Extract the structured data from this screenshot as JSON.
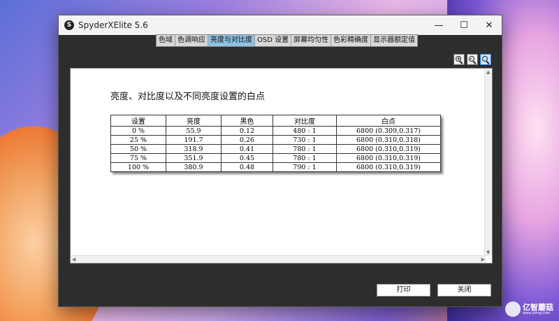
{
  "window": {
    "title": "SpyderXElite 5.6",
    "app_icon": "S"
  },
  "controls": {
    "minimize": "—",
    "maximize": "☐",
    "close": "✕"
  },
  "tabs": [
    {
      "label": "色域"
    },
    {
      "label": "色调响应"
    },
    {
      "label": "亮度与对比度",
      "active": true
    },
    {
      "label": "OSD 设置"
    },
    {
      "label": "屏幕均匀性"
    },
    {
      "label": "色彩精确度"
    },
    {
      "label": "显示器额定值"
    }
  ],
  "document": {
    "title": "亮度、对比度以及不同亮度设置的白点",
    "table": {
      "headers": [
        "设置",
        "亮度",
        "黑色",
        "对比度",
        "白点"
      ],
      "rows": [
        [
          "0 %",
          "55.9",
          "0.12",
          "480 : 1",
          "6800 (0.309,0.317)"
        ],
        [
          "25 %",
          "191.7",
          "0.26",
          "730 : 1",
          "6800 (0.310,0.318)"
        ],
        [
          "50 %",
          "318.9",
          "0.41",
          "780 : 1",
          "6800 (0.310,0.319)"
        ],
        [
          "75 %",
          "351.9",
          "0.45",
          "780 : 1",
          "6800 (0.310,0.319)"
        ],
        [
          "100 %",
          "380.9",
          "0.48",
          "790 : 1",
          "6800 (0.310,0.319)"
        ]
      ]
    }
  },
  "buttons": {
    "print": "打印",
    "close": "关闭"
  },
  "watermark": {
    "name": "亿智蘑菇",
    "url": "www.yzmg.com"
  }
}
